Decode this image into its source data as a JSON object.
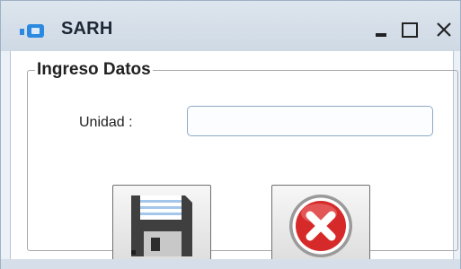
{
  "window": {
    "title": "SARH",
    "controls": {
      "minimize": "minimize-icon",
      "maximize": "maximize-icon",
      "close": "close-icon"
    }
  },
  "form": {
    "legend": "Ingreso Datos",
    "unit_label": "Unidad :",
    "unit_value": ""
  },
  "buttons": {
    "save_icon": "floppy-disk-icon",
    "cancel_icon": "red-x-circle-icon"
  },
  "colors": {
    "title_bar": "#dde5ee",
    "window_bg": "#ecf1f7",
    "content_bg": "#ffffff",
    "input_border": "#8fa9c6",
    "app_icon_blue": "#2b8ae0",
    "cancel_red": "#d62a2a",
    "floppy_dark": "#3f3f3f"
  }
}
